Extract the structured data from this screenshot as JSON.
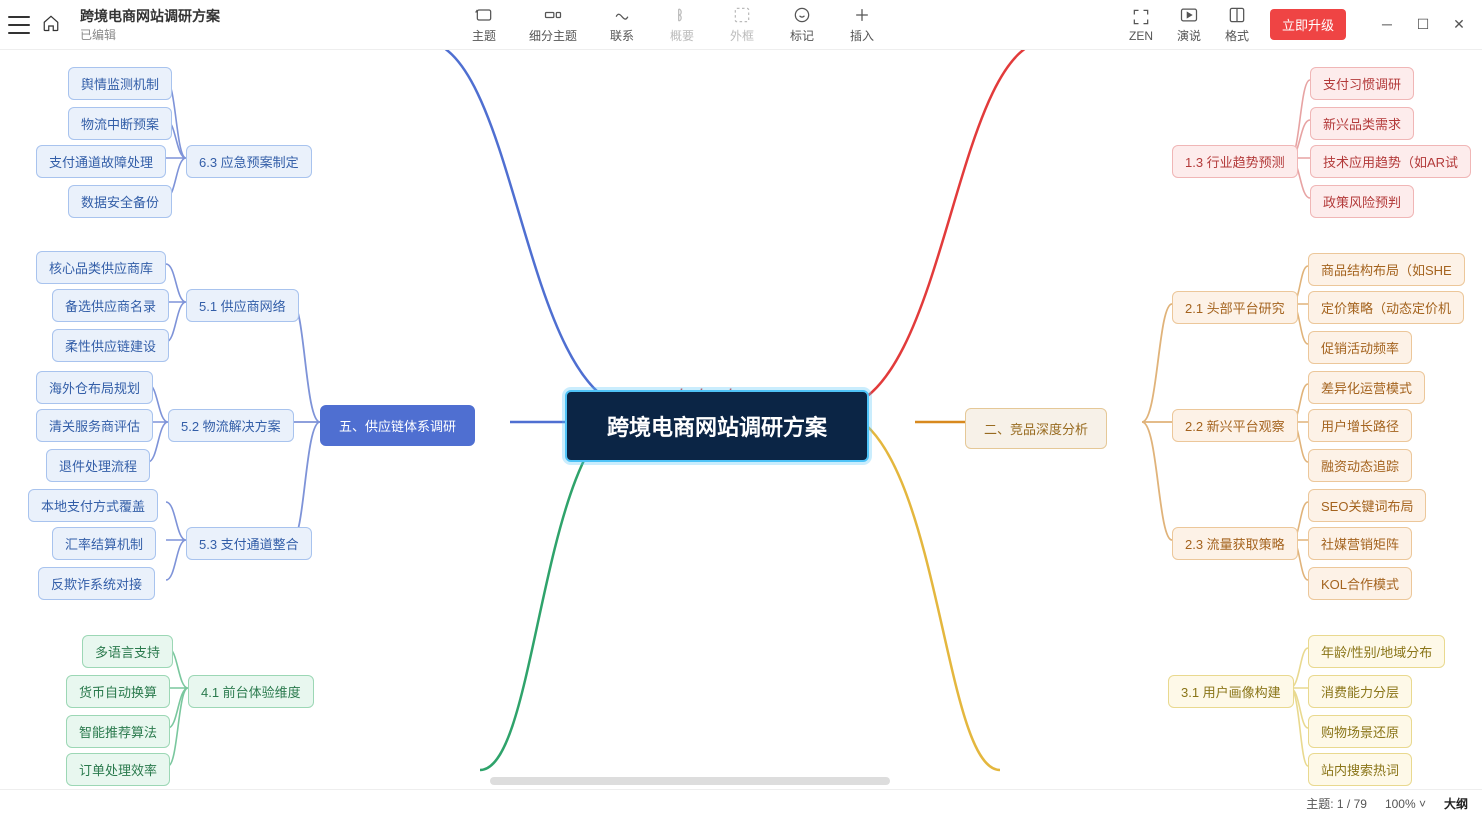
{
  "header": {
    "doc_name": "跨境电商网站调研方案",
    "doc_status": "已编辑",
    "tools": {
      "theme": "主题",
      "subtopic": "细分主题",
      "relation": "联系",
      "summary": "概要",
      "boundary": "外框",
      "marker": "标记",
      "insert": "插入",
      "zen": "ZEN",
      "present": "演说",
      "format": "格式"
    },
    "upgrade": "立即升级"
  },
  "watermark": "songshuhezi.com",
  "root": "跨境电商网站调研方案",
  "left": {
    "b6_3": {
      "label": "6.3 应急预案制定",
      "leaves": [
        "舆情监测机制",
        "物流中断预案",
        "支付通道故障处理",
        "数据安全备份"
      ]
    },
    "b5": {
      "label": "五、供应链体系调研",
      "b5_1": {
        "label": "5.1 供应商网络",
        "leaves": [
          "核心品类供应商库",
          "备选供应商名录",
          "柔性供应链建设"
        ]
      },
      "b5_2": {
        "label": "5.2 物流解决方案",
        "leaves": [
          "海外仓布局规划",
          "清关服务商评估",
          "退件处理流程"
        ]
      },
      "b5_3": {
        "label": "5.3 支付通道整合",
        "leaves": [
          "本地支付方式覆盖",
          "汇率结算机制",
          "反欺诈系统对接"
        ]
      }
    },
    "b4_1": {
      "label": "4.1 前台体验维度",
      "leaves": [
        "多语言支持",
        "货币自动换算",
        "智能推荐算法",
        "订单处理效率"
      ]
    }
  },
  "right": {
    "b1_3": {
      "label": "1.3 行业趋势预测",
      "leaves": [
        "支付习惯调研",
        "新兴品类需求",
        "技术应用趋势（如AR试",
        "政策风险预判"
      ]
    },
    "b2": {
      "label": "二、竞品深度分析",
      "b2_1": {
        "label": "2.1 头部平台研究",
        "leaves": [
          "商品结构布局（如SHE",
          "定价策略（动态定价机",
          "促销活动频率"
        ]
      },
      "b2_2": {
        "label": "2.2 新兴平台观察",
        "leaves": [
          "差异化运营模式",
          "用户增长路径",
          "融资动态追踪"
        ]
      },
      "b2_3": {
        "label": "2.3 流量获取策略",
        "leaves": [
          "SEO关键词布局",
          "社媒营销矩阵",
          "KOL合作模式"
        ]
      }
    },
    "b3_1": {
      "label": "3.1 用户画像构建",
      "leaves": [
        "年龄/性别/地域分布",
        "消费能力分层",
        "购物场景还原",
        "站内搜索热词"
      ]
    }
  },
  "status": {
    "topic": "主题: 1 / 79",
    "zoom": "100%",
    "outline": "大纲"
  },
  "chart_data": {
    "type": "mindmap",
    "title": "跨境电商网站调研方案",
    "root": "跨境电商网站调研方案",
    "visible_branches": [
      {
        "side": "left",
        "id": "6.3",
        "label": "6.3 应急预案制定",
        "children": [
          "舆情监测机制",
          "物流中断预案",
          "支付通道故障处理",
          "数据安全备份"
        ]
      },
      {
        "side": "left",
        "id": "5",
        "label": "五、供应链体系调研",
        "children": [
          {
            "id": "5.1",
            "label": "5.1 供应商网络",
            "children": [
              "核心品类供应商库",
              "备选供应商名录",
              "柔性供应链建设"
            ]
          },
          {
            "id": "5.2",
            "label": "5.2 物流解决方案",
            "children": [
              "海外仓布局规划",
              "清关服务商评估",
              "退件处理流程"
            ]
          },
          {
            "id": "5.3",
            "label": "5.3 支付通道整合",
            "children": [
              "本地支付方式覆盖",
              "汇率结算机制",
              "反欺诈系统对接"
            ]
          }
        ]
      },
      {
        "side": "left",
        "id": "4.1",
        "label": "4.1 前台体验维度",
        "children": [
          "多语言支持",
          "货币自动换算",
          "智能推荐算法",
          "订单处理效率"
        ]
      },
      {
        "side": "right",
        "id": "1.3",
        "label": "1.3 行业趋势预测",
        "children": [
          "支付习惯调研",
          "新兴品类需求",
          "技术应用趋势（如AR试…",
          "政策风险预判"
        ]
      },
      {
        "side": "right",
        "id": "2",
        "label": "二、竞品深度分析",
        "children": [
          {
            "id": "2.1",
            "label": "2.1 头部平台研究",
            "children": [
              "商品结构布局（如SHE…",
              "定价策略（动态定价机…",
              "促销活动频率"
            ]
          },
          {
            "id": "2.2",
            "label": "2.2 新兴平台观察",
            "children": [
              "差异化运营模式",
              "用户增长路径",
              "融资动态追踪"
            ]
          },
          {
            "id": "2.3",
            "label": "2.3 流量获取策略",
            "children": [
              "SEO关键词布局",
              "社媒营销矩阵",
              "KOL合作模式"
            ]
          }
        ]
      },
      {
        "side": "right",
        "id": "3.1",
        "label": "3.1 用户画像构建",
        "children": [
          "年龄/性别/地域分布",
          "消费能力分层",
          "购物场景还原",
          "站内搜索热词"
        ]
      }
    ]
  }
}
